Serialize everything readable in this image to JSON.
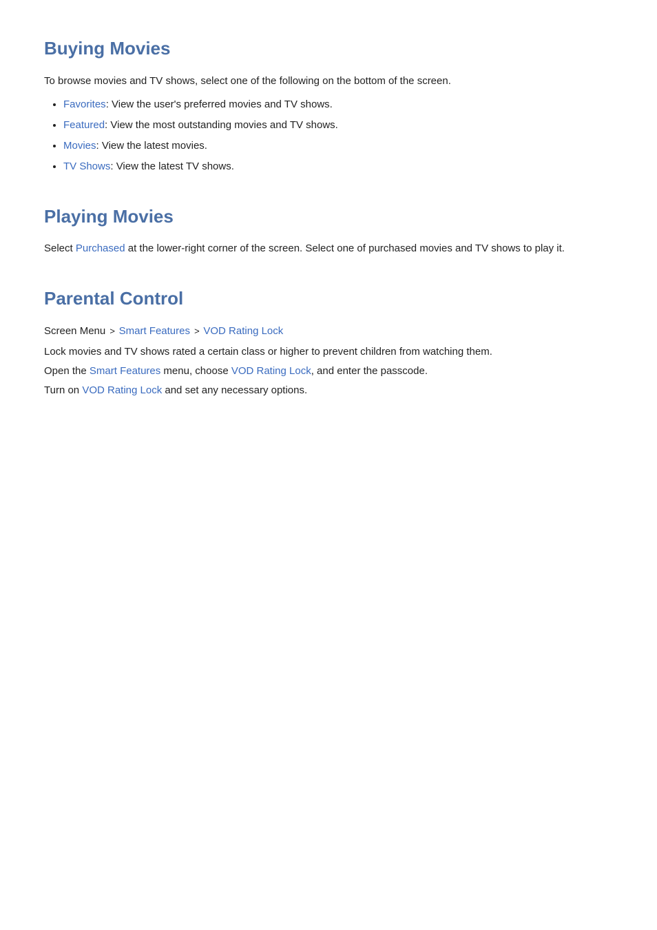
{
  "buying_movies": {
    "title": "Buying Movies",
    "intro": "To browse movies and TV shows, select one of the following on the bottom of the screen.",
    "items": [
      {
        "link_text": "Favorites",
        "description": ": View the user's preferred movies and TV shows."
      },
      {
        "link_text": "Featured",
        "description": ": View the most outstanding movies and TV shows."
      },
      {
        "link_text": "Movies",
        "description": ": View the latest movies."
      },
      {
        "link_text": "TV Shows",
        "description": ": View the latest TV shows."
      }
    ]
  },
  "playing_movies": {
    "title": "Playing Movies",
    "intro_before": "Select ",
    "intro_link": "Purchased",
    "intro_after": " at the lower-right corner of the screen. Select one of purchased movies and TV shows to play it."
  },
  "parental_control": {
    "title": "Parental Control",
    "breadcrumb": {
      "prefix": "Screen Menu",
      "chevron": ">",
      "item1": "Smart Features",
      "chevron2": ">",
      "item2": "VOD Rating Lock"
    },
    "lines": [
      {
        "text": "Lock movies and TV shows rated a certain class or higher to prevent children from watching them."
      },
      {
        "before": "Open the ",
        "link1": "Smart Features",
        "middle": " menu, choose ",
        "link2": "VOD Rating Lock",
        "after": ", and enter the passcode."
      },
      {
        "before": "Turn on ",
        "link": "VOD Rating Lock",
        "after": " and set any necessary options."
      }
    ]
  },
  "colors": {
    "link": "#3a6bbf",
    "heading": "#4a6fa5"
  }
}
